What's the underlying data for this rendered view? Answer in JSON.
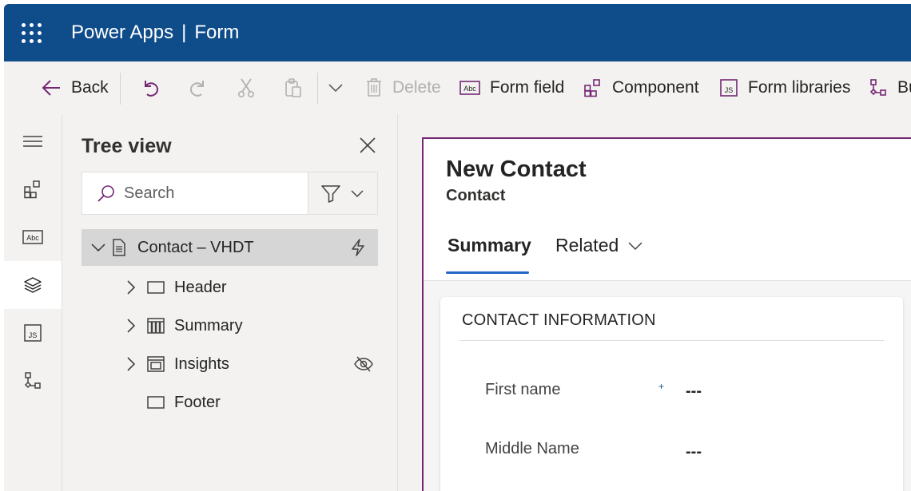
{
  "header": {
    "app_name": "Power Apps",
    "separator": "|",
    "page_name": "Form",
    "bg_color": "#0f4c8a"
  },
  "commands": {
    "back": "Back",
    "delete": "Delete",
    "form_field": "Form field",
    "component": "Component",
    "form_libraries": "Form libraries",
    "business_rules": "Bu"
  },
  "rail": {
    "items": [
      "menu-icon",
      "components-icon",
      "form-field-icon",
      "layers-icon",
      "form-libraries-icon",
      "business-rules-icon"
    ],
    "active": "layers-icon"
  },
  "tree_view": {
    "title": "Tree view",
    "search_placeholder": "Search",
    "root": "Contact – VHDT",
    "nodes": [
      "Header",
      "Summary",
      "Insights",
      "Footer"
    ]
  },
  "form": {
    "title": "New Contact",
    "entity": "Contact",
    "tabs": [
      "Summary",
      "Related"
    ],
    "active_tab": "Summary",
    "section_title": "CONTACT INFORMATION",
    "required_marker": "+",
    "fields": [
      {
        "label": "First name",
        "value": "---"
      },
      {
        "label": "Middle Name",
        "value": "---"
      }
    ],
    "accent_color": "#742774",
    "tab_underline_color": "#2266c4"
  }
}
